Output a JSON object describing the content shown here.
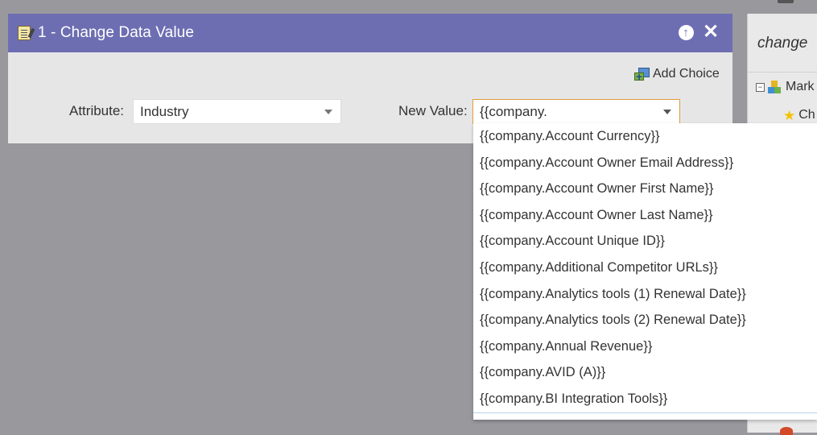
{
  "right_panel": {
    "search_text": "change",
    "tree": [
      {
        "label": "Mark",
        "icon": "blocks-icon"
      },
      {
        "label": "Ch",
        "icon": "star-icon"
      }
    ]
  },
  "step": {
    "title": "1 - Change Data Value",
    "icon": "edit-note-icon",
    "add_choice_label": "Add Choice",
    "attribute_label": "Attribute:",
    "attribute_value": "Industry",
    "new_value_label": "New Value:",
    "new_value_text": "{{company."
  },
  "dropdown": {
    "options": [
      "{{company.Account Currency}}",
      "{{company.Account Owner Email Address}}",
      "{{company.Account Owner First Name}}",
      "{{company.Account Owner Last Name}}",
      "{{company.Account Unique ID}}",
      "{{company.Additional Competitor URLs}}",
      "{{company.Analytics tools (1) Renewal Date}}",
      "{{company.Analytics tools (2) Renewal Date}}",
      "{{company.Annual Revenue}}",
      "{{company.AVID (A)}}",
      "{{company.BI Integration Tools}}"
    ]
  },
  "colors": {
    "header": "#6d6eb2",
    "backdrop": "#99989d",
    "card": "#e6e6e6",
    "focus_border": "#e39a3c"
  }
}
